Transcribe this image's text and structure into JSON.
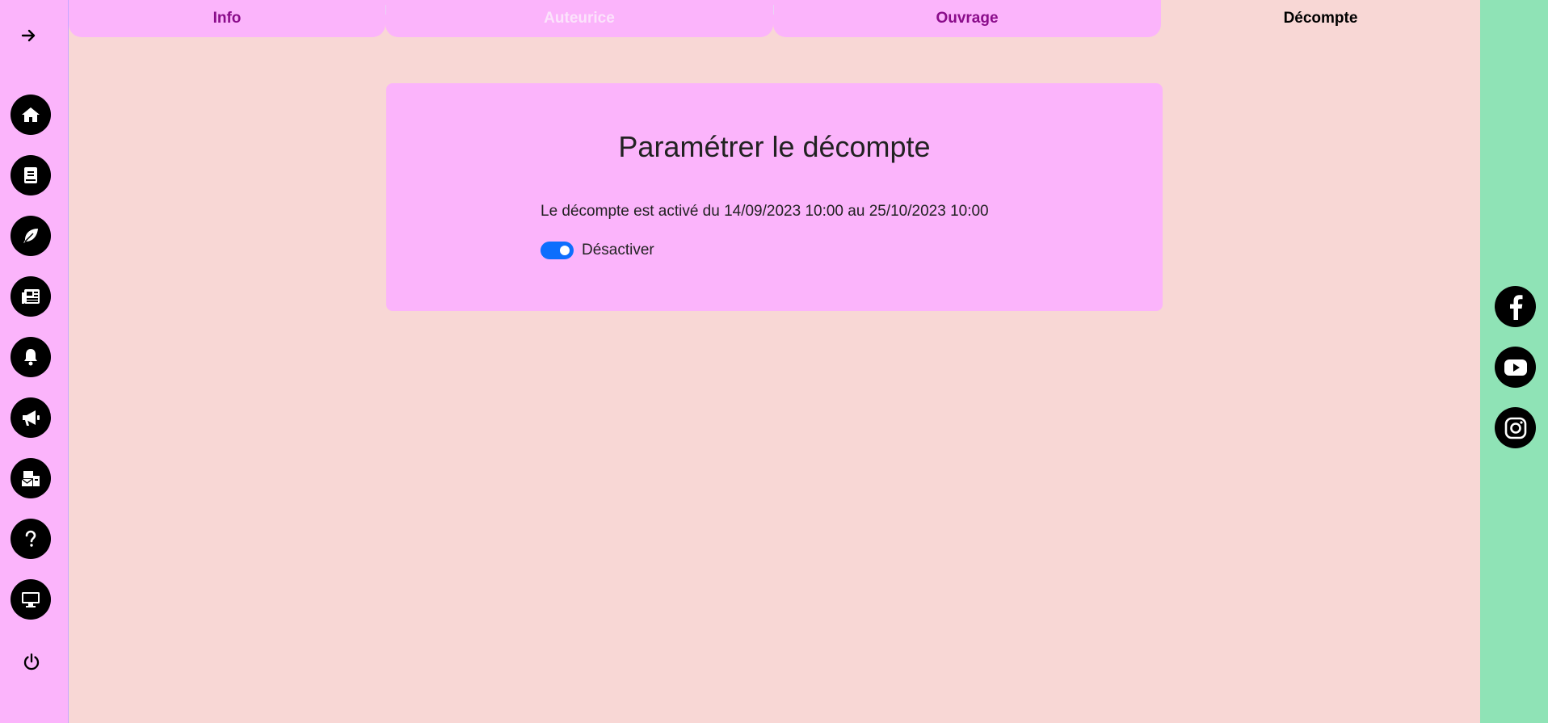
{
  "tabs": {
    "info": "Info",
    "auteurice": "Auteurice",
    "ouvrage": "Ouvrage",
    "decompte": "Décompte"
  },
  "sidebar": {
    "icons": [
      "arrow-right-icon",
      "home-icon",
      "book-icon",
      "feather-icon",
      "newspaper-icon",
      "bell-icon",
      "megaphone-icon",
      "mail-bulk-icon",
      "question-icon",
      "desktop-icon",
      "power-icon"
    ]
  },
  "social": {
    "icons": [
      "facebook-icon",
      "youtube-icon",
      "instagram-icon"
    ]
  },
  "card": {
    "title": "Paramétrer le décompte",
    "status_text": "Le décompte est activé du 14/09/2023 10:00 au 25/10/2023 10:00",
    "toggle_label": "Désactiver",
    "toggle_on": true
  },
  "colors": {
    "page_bg": "#f8d7d5",
    "sidebar_bg": "#fbb4fb",
    "rightbar_bg": "#8fe3b6",
    "switch_on": "#0d6efd"
  }
}
